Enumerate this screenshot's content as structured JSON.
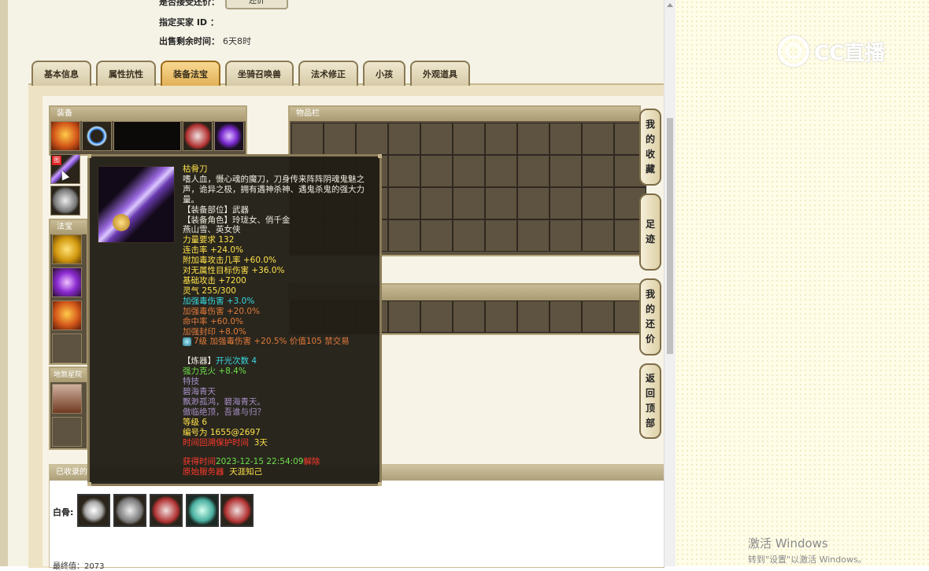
{
  "header_info": {
    "seller_label": "指定买家 ID ：",
    "remaining_label": "出售剩余时间：",
    "remaining_value": "6天8时",
    "top_cut_label": "是否接受还价：",
    "top_btn": "还价"
  },
  "tabs": [
    {
      "label": "基本信息",
      "active": false
    },
    {
      "label": "属性抗性",
      "active": false
    },
    {
      "label": "装备法宝",
      "active": true
    },
    {
      "label": "坐骑召唤兽",
      "active": false
    },
    {
      "label": "法术修正",
      "active": false
    },
    {
      "label": "小孩",
      "active": false
    },
    {
      "label": "外观道具",
      "active": false
    }
  ],
  "panels": {
    "equip_title": "装备",
    "fabao_title": "法宝",
    "char_title": "地煞星院",
    "inventory_title": "物品栏",
    "collected_title": "已收录的",
    "collected_row_label": "白骨:",
    "collected_footer": "最终值：2073"
  },
  "equip_badge": "图",
  "side_buttons": [
    {
      "label": "我的收藏",
      "chars": [
        "我",
        "的",
        "收",
        "藏"
      ]
    },
    {
      "label": "足迹",
      "chars": [
        "足",
        "迹"
      ]
    },
    {
      "label": "我的还价",
      "chars": [
        "我",
        "的",
        "还",
        "价"
      ]
    },
    {
      "label": "返回顶部",
      "chars": [
        "返",
        "回",
        "顶",
        "部"
      ]
    }
  ],
  "tooltip": {
    "name": "枯骨刀",
    "description": "嗜人血，慑心魂的魔刀，刀身传来阵阵阴魂鬼魅之声，诡异之极，拥有遇神杀神、遇鬼杀鬼的强大力量。",
    "lines": [
      {
        "text": "【装备部位】武器",
        "color": "white"
      },
      {
        "text": "【装备角色】玲珑女、俏千金",
        "color": "white"
      },
      {
        "text": "燕山雪、英女侠",
        "color": "white"
      },
      {
        "text": "力量要求 132",
        "color": "yellow"
      },
      {
        "text": "连击率 +24.0%",
        "color": "yellow"
      },
      {
        "text": "附加毒攻击几率 +60.0%",
        "color": "yellow"
      },
      {
        "text": "对无属性目标伤害 +36.0%",
        "color": "yellow"
      },
      {
        "text": "基础攻击 +7200",
        "color": "yellow"
      },
      {
        "text": "灵气 255/300",
        "color": "yellow"
      },
      {
        "text": "加强毒伤害 +3.0%",
        "color": "cyan"
      },
      {
        "text": "加强毒伤害 +20.0%",
        "color": "orange"
      },
      {
        "text": "命中率 +60.0%",
        "color": "orange"
      },
      {
        "text": "加强封印 +8.0%",
        "color": "orange"
      }
    ],
    "gem_line": "7级 加强毒伤害 +20.5% 价值105 禁交易",
    "refine_prefix": "【炼器】",
    "refine_count": "开光次数 4",
    "refine_stat": "强力克火 +8.4%",
    "skill_title": "特技",
    "skill_name": "碧海青天",
    "poem_1": "飘渺孤鸿，碧海青天。",
    "poem_2": "傲临绝顶，吾谁与归？",
    "level": "等级 6",
    "serial": "编号为 1655@2697",
    "protect_label": "时间回溯保护时间",
    "protect_value": "3天",
    "time_label": "获得时间",
    "time_value": "2023-12-15 22:54:09",
    "time_suffix": "解除",
    "server_label": "原始服务器",
    "server_value": "天涯知己"
  },
  "overlay": {
    "logo_text": "CC直播",
    "activate_title": "激活 Windows",
    "activate_sub": "转到\"设置\"以激活 Windows。"
  }
}
